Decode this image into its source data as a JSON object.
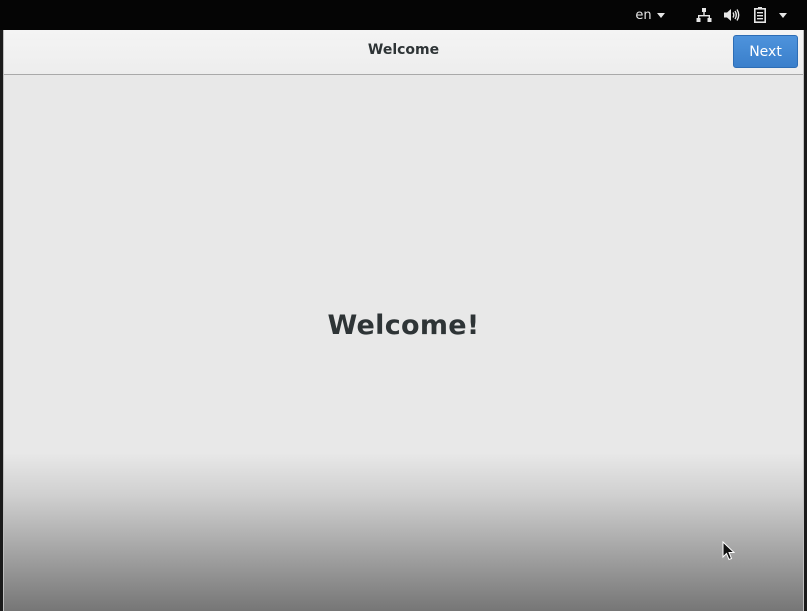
{
  "top_bar": {
    "language": "en",
    "icons": {
      "network": "network-wired-icon",
      "volume": "audio-volume-icon",
      "battery": "battery-icon",
      "system_menu": "caret-down-icon"
    }
  },
  "window": {
    "header": {
      "title": "Welcome",
      "next_label": "Next"
    },
    "content": {
      "heading": "Welcome!"
    }
  },
  "colors": {
    "accent": "#3a7fcb",
    "top_bar": "#050505",
    "window_bg": "#e8e8e8",
    "text": "#2e3436"
  }
}
